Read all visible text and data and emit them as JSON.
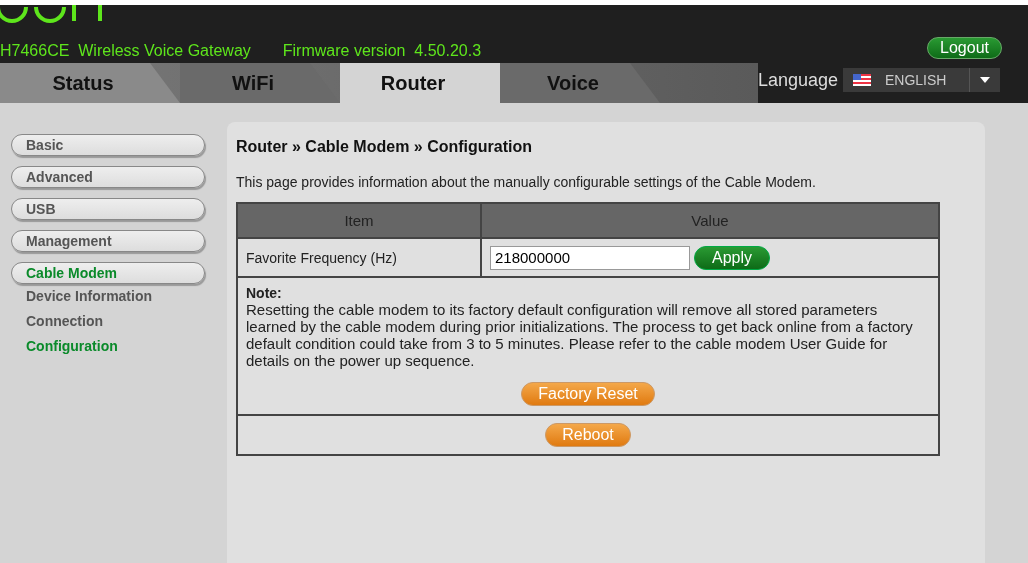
{
  "header": {
    "model": "H7466CE  Wireless Voice Gateway",
    "firmware": "Firmware version  4.50.20.3",
    "logout": "Logout",
    "language_label": "Language",
    "language": "ENGLISH"
  },
  "tabs": [
    {
      "label": "Status",
      "selected": false
    },
    {
      "label": "WiFi",
      "selected": false
    },
    {
      "label": "Router",
      "selected": true
    },
    {
      "label": "Voice",
      "selected": false
    }
  ],
  "sidebar": {
    "items": [
      {
        "label": "Basic",
        "selected": false
      },
      {
        "label": "Advanced",
        "selected": false
      },
      {
        "label": "USB",
        "selected": false
      },
      {
        "label": "Management",
        "selected": false
      },
      {
        "label": "Cable Modem",
        "selected": true,
        "children": [
          {
            "label": "Device Information",
            "selected": false
          },
          {
            "label": "Connection",
            "selected": false
          },
          {
            "label": "Configuration",
            "selected": true
          }
        ]
      }
    ]
  },
  "page": {
    "breadcrumb": "Router » Cable Modem » Configuration",
    "description": "This page provides information about the manually configurable settings of the Cable Modem.",
    "table": {
      "columns": [
        "Item",
        "Value"
      ],
      "rows": [
        {
          "label": "Favorite Frequency (Hz)",
          "value": "218000000",
          "button": "Apply"
        }
      ]
    },
    "note": {
      "title": "Note:",
      "text": "Resetting the cable modem to its factory default configuration will remove all stored parameters learned by the cable modem during prior initializations. The process to get back online from a factory default condition could take from 3 to 5 minutes. Please refer to the cable modem User Guide for details on the power up sequence.",
      "button": "Factory Reset"
    },
    "reboot": "Reboot"
  }
}
